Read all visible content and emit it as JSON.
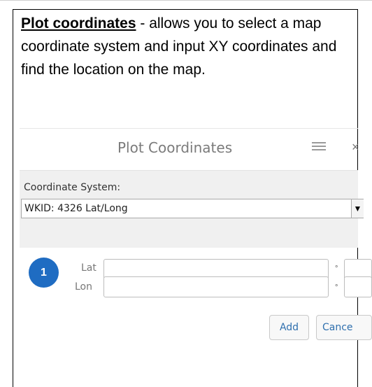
{
  "intro": {
    "link_text": "Plot coordinates",
    "description": " - allows you to select a map coordinate system and input XY coordinates and find the location on the map."
  },
  "panel": {
    "title": "Plot Coordinates",
    "menu_icon": "hamburger-menu-icon",
    "close_icon": "close-icon",
    "close_glyph": "×"
  },
  "coordinate_system": {
    "label": "Coordinate System:",
    "selected": "WKID: 4326 Lat/Long",
    "dropdown_glyph": "▼"
  },
  "point": {
    "number": "1",
    "lat_label": "Lat",
    "lon_label": "Lon",
    "degree_symbol": "°",
    "lat_value": "",
    "lon_value": ""
  },
  "buttons": {
    "add_label": "Add",
    "cancel_label": "Cance"
  },
  "colors": {
    "badge": "#1f6cc2",
    "button_text": "#2f6fae"
  }
}
